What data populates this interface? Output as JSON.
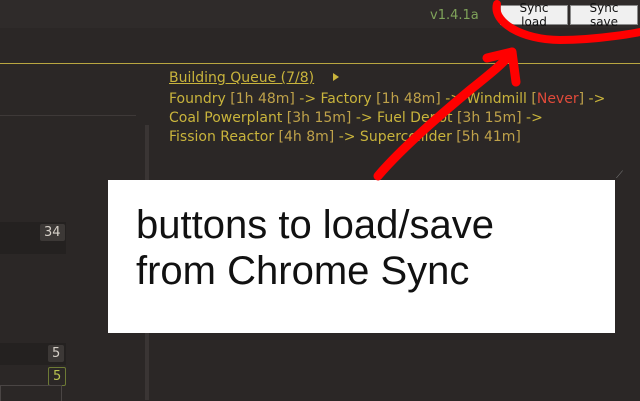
{
  "header": {
    "version": "v1.4.1a",
    "sync_load_label": "Sync load",
    "sync_save_label": "Sync save"
  },
  "building_queue": {
    "title": "Building Queue (7/8)",
    "lines": [
      [
        {
          "text": "Foundry ",
          "kind": "name"
        },
        {
          "text": "[1h 48m]",
          "kind": "time"
        },
        {
          "text": " -> Factory ",
          "kind": "name"
        },
        {
          "text": "[1h 48m]",
          "kind": "time"
        },
        {
          "text": " -> Windmill ",
          "kind": "name"
        },
        {
          "text": "[",
          "kind": "time"
        },
        {
          "text": "Never",
          "kind": "never"
        },
        {
          "text": "]",
          "kind": "time"
        },
        {
          "text": " ->",
          "kind": "name"
        }
      ],
      [
        {
          "text": "Coal Powerplant ",
          "kind": "name"
        },
        {
          "text": "[3h 15m]",
          "kind": "time"
        },
        {
          "text": " -> Fuel Depot ",
          "kind": "name"
        },
        {
          "text": "[3h 15m]",
          "kind": "time"
        },
        {
          "text": " ->",
          "kind": "name"
        }
      ],
      [
        {
          "text": "Fission Reactor ",
          "kind": "name"
        },
        {
          "text": "[4h 8m]",
          "kind": "time"
        },
        {
          "text": " -> Supercollider ",
          "kind": "name"
        },
        {
          "text": "[5h 41m]",
          "kind": "time"
        }
      ]
    ]
  },
  "left_panel": {
    "values": [
      "34",
      "5",
      "5"
    ]
  },
  "annotation": {
    "line1": "buttons to load/save",
    "line2": "from Chrome Sync"
  },
  "colors": {
    "background": "#2b2726",
    "accent": "#c9b43c",
    "version": "#7fa35a",
    "never": "#e04a3a",
    "ink": "#ff0000"
  }
}
